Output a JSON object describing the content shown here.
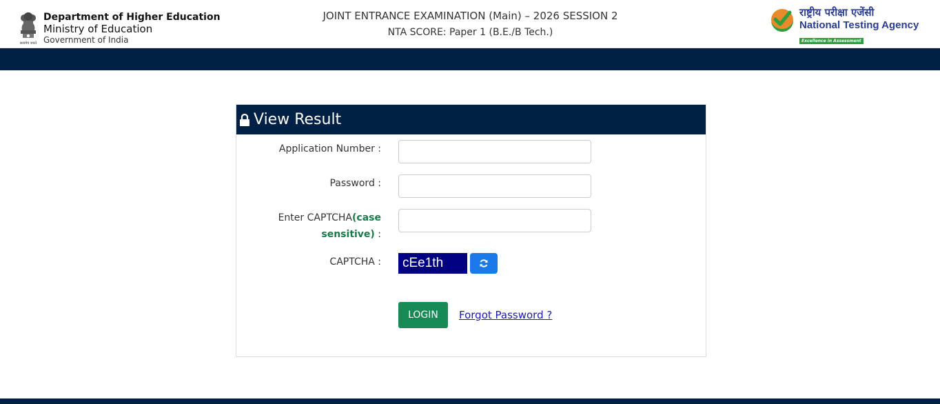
{
  "header": {
    "dept_line1": "Department of Higher Education",
    "dept_line2": "Ministry of Education",
    "dept_line3": "Government of India",
    "exam_title": "JOINT ENTRANCE EXAMINATION (Main) – 2026 SESSION 2",
    "exam_subtitle": "NTA SCORE: Paper 1 (B.E./B Tech.)",
    "nta_hindi": "राष्ट्रीय परीक्षा एजेंसी",
    "nta_english": "National Testing Agency",
    "nta_tagline": "Excellence in Assessment",
    "emblem_motto": "सत्यमेव जयते"
  },
  "panel": {
    "title": "View Result",
    "application_label": "Application Number :",
    "application_value": "",
    "password_label": "Password :",
    "password_value": "",
    "captcha_entry_label_plain": "Enter CAPTCHA",
    "captcha_entry_label_green1": "(case",
    "captcha_entry_label_green2": "sensitive)",
    "captcha_entry_label_suffix": " :",
    "captcha_entry_value": "",
    "captcha_label": "CAPTCHA :",
    "captcha_text": "cEe1th",
    "login_label": "LOGIN",
    "forgot_label": "Forgot Password ?"
  },
  "colors": {
    "navy": "#002145",
    "login_green": "#178a55",
    "captcha_bg": "#000080",
    "refresh_blue": "#1a7ae8",
    "link_blue": "#1a1aa8"
  }
}
